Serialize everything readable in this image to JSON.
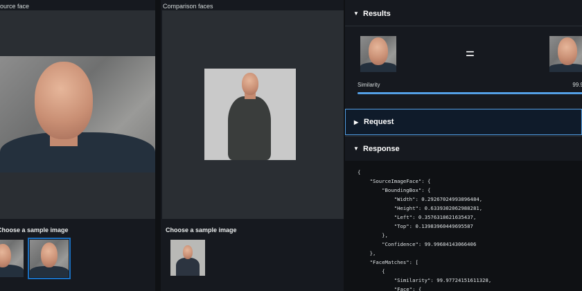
{
  "source": {
    "title": "Source face",
    "sample_label": "Choose a sample image"
  },
  "comparison": {
    "title": "Comparison faces",
    "sample_label": "Choose a sample image"
  },
  "results": {
    "title": "Results",
    "similarity_label": "Similarity",
    "similarity_value": "99.9",
    "similarity_fraction": 0.9997
  },
  "request": {
    "title": "Request"
  },
  "response": {
    "title": "Response",
    "lines": [
      "{",
      "    \"SourceImageFace\": {",
      "        \"BoundingBox\": {",
      "            \"Width\": 0.29267024993896484,",
      "            \"Height\": 0.6339302062988281,",
      "            \"Left\": 0.3576318621635437,",
      "            \"Top\": 0.13983960449695587",
      "        },",
      "        \"Confidence\": 99.99684143066406",
      "    },",
      "    \"FaceMatches\": [",
      "        {",
      "            \"Similarity\": 99.97724151611328,",
      "            \"Face\": {"
    ]
  },
  "colors": {
    "accent": "#539fe5",
    "selected_outline": "#1b6fbf"
  },
  "icons": {
    "equals": "=",
    "caret_down": "▼",
    "caret_right": "▶"
  }
}
